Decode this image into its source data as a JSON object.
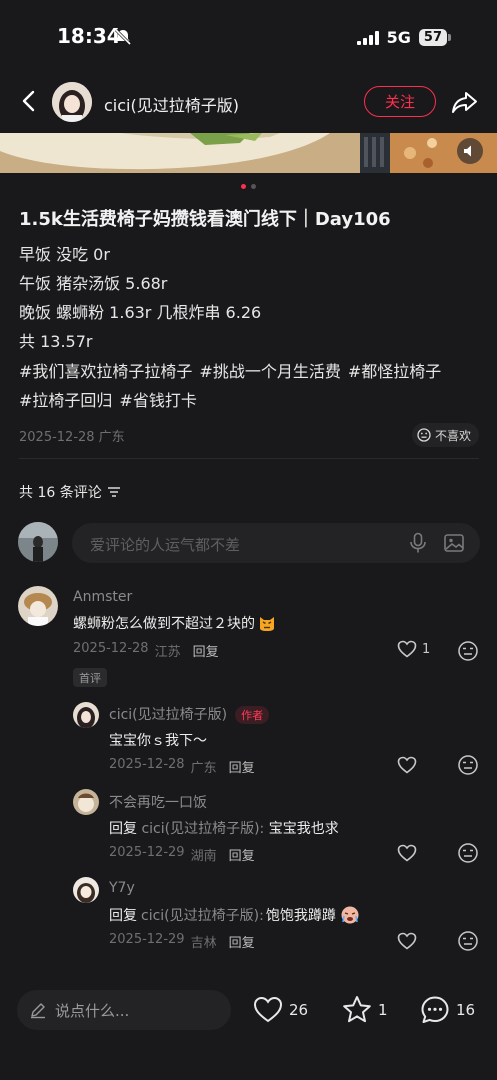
{
  "status": {
    "time": "18:34",
    "network": "5G",
    "battery": "57"
  },
  "header": {
    "author": "cici(见过拉椅子版)",
    "follow": "关注"
  },
  "post": {
    "title": "1.5k生活费椅子妈攒钱看澳门线下｜Day106",
    "lines": [
      "早饭 没吃 0r",
      "午饭 猪杂汤饭 5.68r",
      "晚饭 螺蛳粉 1.63r 几根炸串 6.26",
      "共 13.57r"
    ],
    "tags_row1": [
      "#我们喜欢拉椅子拉椅子",
      "#挑战一个月生活费",
      "#都怪拉椅子"
    ],
    "tags_row2": [
      "#拉椅子回归",
      "#省钱打卡"
    ],
    "meta": "2025-12-28 广东",
    "dislike": "不喜欢"
  },
  "comments_header": {
    "count": "共 16 条评论"
  },
  "comment_input": {
    "placeholder": "爱评论的人运气都不差"
  },
  "comments": [
    {
      "name": "Anmster",
      "text": "螺蛳粉怎么做到不超过２块的",
      "date": "2025-12-28",
      "location": "江苏",
      "reply": "回复",
      "likes": "1",
      "badge": "首评"
    },
    {
      "name": "cici(见过拉椅子版)",
      "author_badge": "作者",
      "text": "宝宝你ｓ我下～",
      "date": "2025-12-28",
      "location": "广东",
      "reply": "回复"
    },
    {
      "name": "不会再吃一口饭",
      "reply_prefix": "回复",
      "reply_to": "cici(见过拉椅子版):",
      "text": "宝宝我也求",
      "date": "2025-12-29",
      "location": "湖南",
      "reply": "回复"
    },
    {
      "name": "Y7y",
      "reply_prefix": "回复",
      "reply_to": "cici(见过拉椅子版):",
      "text": "饱饱我蹲蹲",
      "date": "2025-12-29",
      "location": "吉林",
      "reply": "回复"
    }
  ],
  "bottom_bar": {
    "placeholder": "说点什么...",
    "likes": "26",
    "stars": "1",
    "comments": "16"
  },
  "colors": {
    "accent": "#ff2e4d",
    "background": "#19191b"
  }
}
